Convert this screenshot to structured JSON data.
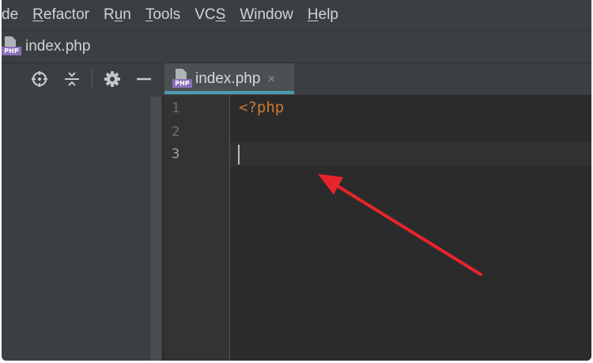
{
  "menubar": {
    "items": [
      {
        "pre": "",
        "ul": "",
        "post": "de"
      },
      {
        "pre": "",
        "ul": "R",
        "post": "efactor"
      },
      {
        "pre": "R",
        "ul": "u",
        "post": "n"
      },
      {
        "pre": "",
        "ul": "T",
        "post": "ools"
      },
      {
        "pre": "VC",
        "ul": "S",
        "post": ""
      },
      {
        "pre": "",
        "ul": "W",
        "post": "indow"
      },
      {
        "pre": "",
        "ul": "H",
        "post": "elp"
      }
    ]
  },
  "navbar": {
    "file_icon_tag": "PHP",
    "file_name": "index.php"
  },
  "toolbar": {
    "icons": [
      "crosshair-icon",
      "collapse-icon",
      "gear-icon",
      "minimize-icon"
    ]
  },
  "tab": {
    "icon_tag": "PHP",
    "label": "index.php",
    "close_glyph": "×"
  },
  "gutter": {
    "line_numbers": [
      "1",
      "2",
      "3"
    ]
  },
  "editor": {
    "lines": [
      "<?php",
      "",
      ""
    ],
    "caret_line": 3
  },
  "colors": {
    "background": "#2b2b2b",
    "panel": "#3c3f41",
    "keyword": "#cc7832",
    "tab_accent": "#4a9bb0",
    "php_badge": "#8a6fb9",
    "annotation_arrow": "#e8242b"
  },
  "annotation": {
    "arrow_icon": "red-arrow-icon"
  }
}
